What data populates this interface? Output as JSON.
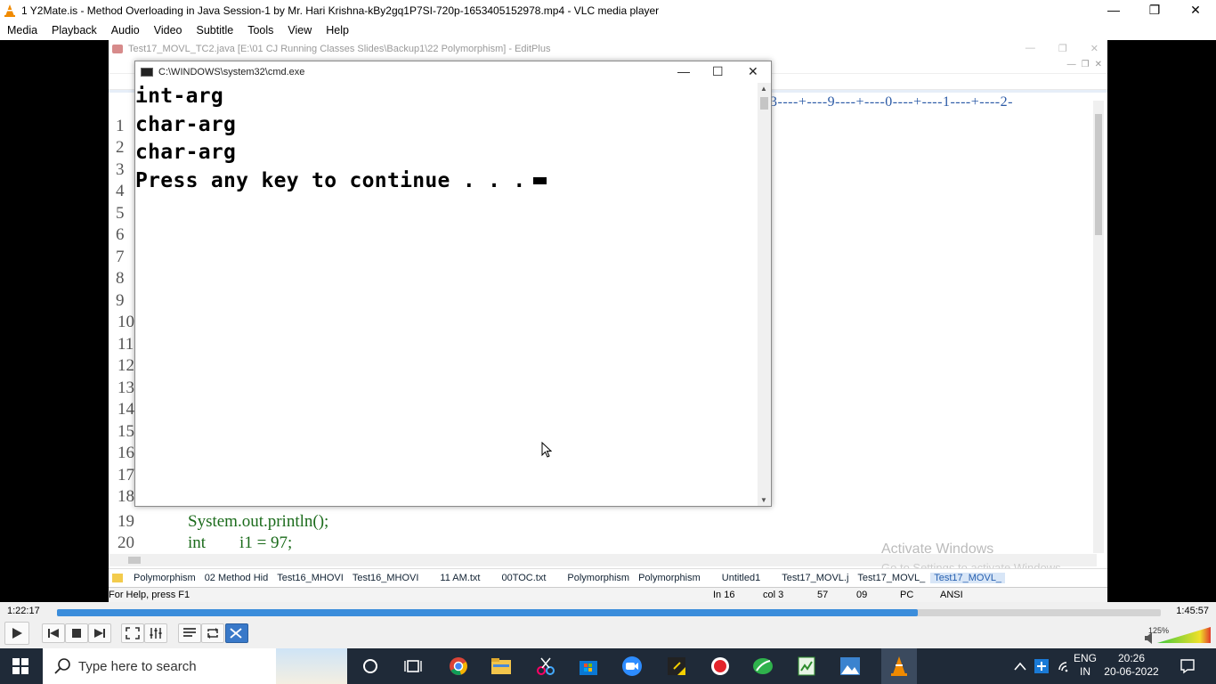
{
  "vlc": {
    "title": "1 Y2Mate.is - Method Overloading in Java  Session-1  by Mr. Hari Krishna-kBy2gq1P7SI-720p-1653405152978.mp4 - VLC media player",
    "menu": [
      "Media",
      "Playback",
      "Audio",
      "Video",
      "Subtitle",
      "Tools",
      "View",
      "Help"
    ],
    "time_elapsed": "1:22:17",
    "time_total": "1:45:57",
    "progress_fraction": 0.78,
    "volume_label": "125%"
  },
  "editplus": {
    "title": "Test17_MOVL_TC2.java [E:\\01 CJ Running Classes Slides\\Backup1\\22 Polymorphism] - EditPlus",
    "ruler": "3----+----9----+----0----+----1----+----2-",
    "line_numbers": [
      "1",
      "2",
      "3",
      "4",
      "5",
      "6",
      "7",
      "8",
      "9",
      "10",
      "11",
      "12",
      "13",
      "14",
      "15",
      "16",
      "17",
      "18",
      "19",
      "20"
    ],
    "code": {
      "line19": "System.out.println();",
      "line20": "int        i1 = 97;"
    },
    "watermark": {
      "line1": "Activate Windows",
      "line2": "Go to Settings to activate Windows."
    },
    "tabs": [
      "Polymorphism",
      "02 Method Hid",
      "Test16_MHOVI",
      "Test16_MHOVI",
      "11 AM.txt",
      "00TOC.txt",
      "Polymorphism",
      "Polymorphism",
      "Untitled1",
      "Test17_MOVL.j",
      "Test17_MOVL_",
      "Test17_MOVL_"
    ],
    "status": {
      "help": "For Help, press F1",
      "ln": "In 16",
      "col": "col 3",
      "n1": "57",
      "n2": "09",
      "mode": "PC",
      "encoding": "ANSI"
    }
  },
  "cmd": {
    "title": "C:\\WINDOWS\\system32\\cmd.exe",
    "lines": [
      "int-arg",
      "char-arg",
      "char-arg",
      "Press any key to continue . . ."
    ]
  },
  "taskbar": {
    "search_placeholder": "Type here to search",
    "lang_top": "ENG",
    "lang_bottom": "IN",
    "time": "20:26",
    "date": "20-06-2022"
  }
}
